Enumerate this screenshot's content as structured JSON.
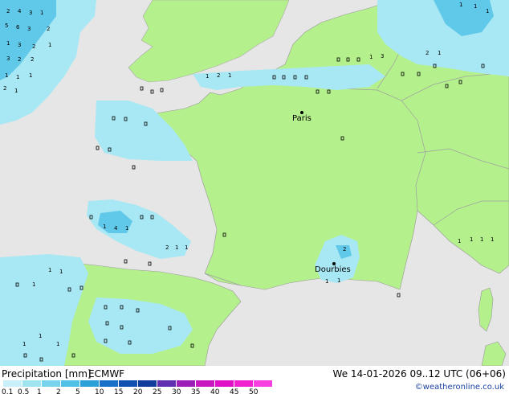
{
  "cities": [
    {
      "name": "Paris"
    },
    {
      "name": "Dourbies"
    }
  ],
  "legend": {
    "title": "Precipitation [mm]",
    "model": "ECMWF",
    "time": "We 14-01-2026 09..12 UTC (06+06)",
    "credit": "©weatheronline.co.uk",
    "ticks": [
      "0.1",
      "0.5",
      "1",
      "2",
      "5",
      "10",
      "15",
      "20",
      "25",
      "30",
      "35",
      "40",
      "45",
      "50"
    ],
    "colors": [
      "#c8f0f8",
      "#a0e4f0",
      "#78d4ec",
      "#50c0e4",
      "#2ca0d8",
      "#1870c8",
      "#1050b0",
      "#103c9c",
      "#6030b0",
      "#9c20b8",
      "#c818c0",
      "#e010c8",
      "#f020d0",
      "#f840e0"
    ]
  },
  "map_colors": {
    "sea": "#e6e6e6",
    "land": "#b4f08c",
    "border": "#999999",
    "precip_light": "#a8e8f4",
    "precip_mid": "#60c8e8"
  }
}
